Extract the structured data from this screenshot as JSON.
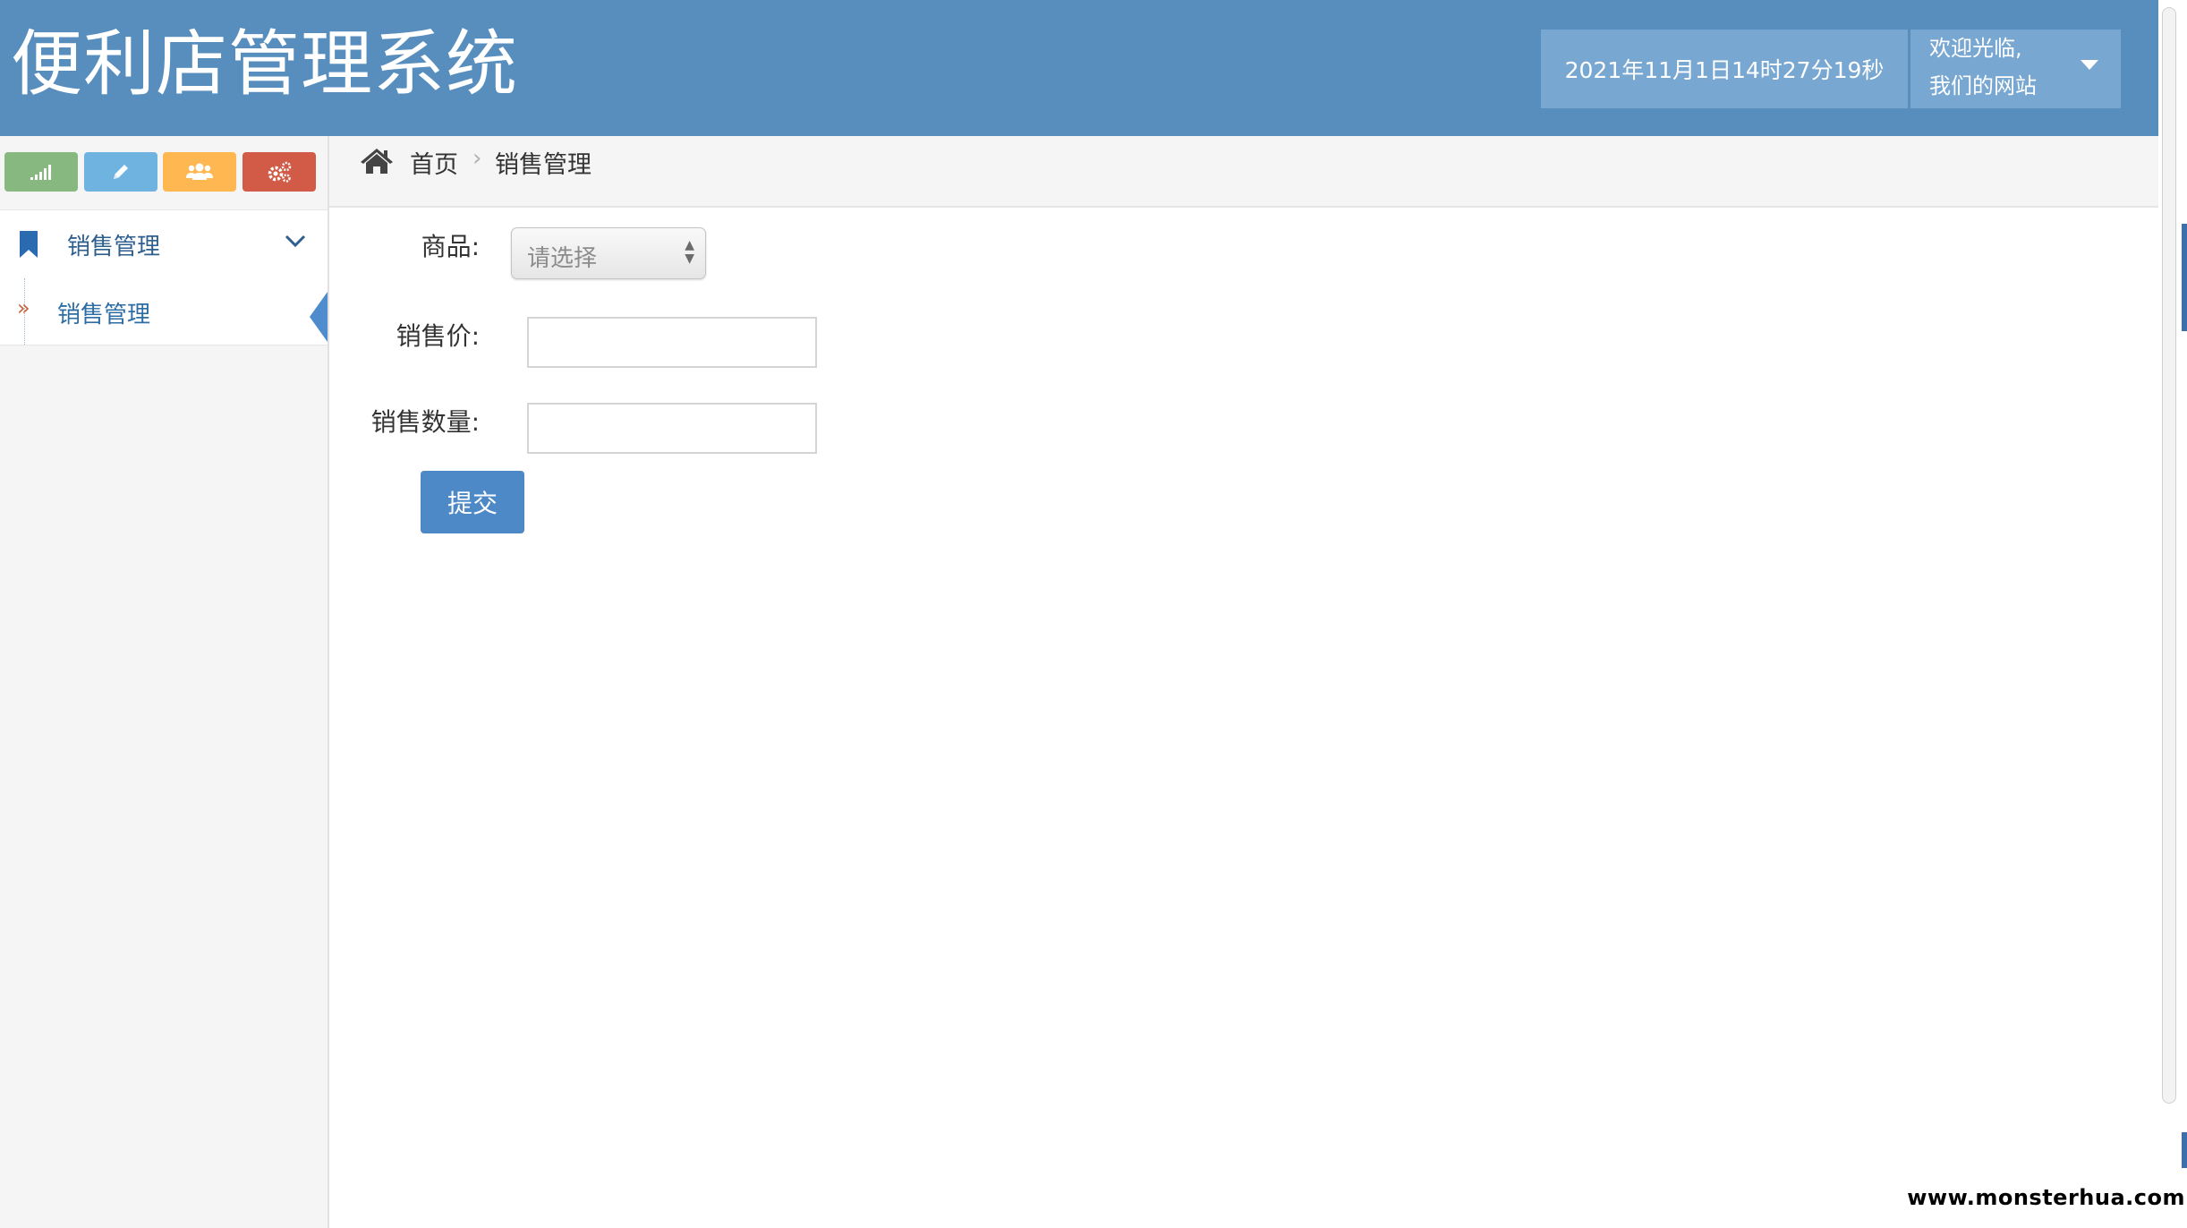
{
  "header": {
    "title": "便利店管理系统",
    "datetime": "2021年11月1日14时27分19秒",
    "welcome_line1": "欢迎光临,",
    "welcome_line2": "我们的网站"
  },
  "sidebar": {
    "shortcuts": [
      {
        "icon": "signal-icon",
        "color": "#87b87f"
      },
      {
        "icon": "pencil-icon",
        "color": "#6fb3e0"
      },
      {
        "icon": "users-icon",
        "color": "#ffb752"
      },
      {
        "icon": "cogs-icon",
        "color": "#d15b47"
      }
    ],
    "menu_label": "销售管理",
    "menu_icon": "bookmark-icon",
    "submenu_label": "销售管理",
    "submenu_marker": "»"
  },
  "breadcrumb": {
    "home": "首页",
    "separator": "›",
    "current": "销售管理"
  },
  "form": {
    "product_label": "商品:",
    "product_placeholder": "请选择",
    "price_label": "销售价:",
    "price_value": "",
    "quantity_label": "销售数量:",
    "quantity_value": "",
    "submit_label": "提交"
  },
  "colors": {
    "header_bg": "#578ebe",
    "header_box_bg": "#78a7d1",
    "primary_button": "#4d88c7",
    "menu_text": "#2e5f8f"
  },
  "watermark": "www.monsterhua.com"
}
